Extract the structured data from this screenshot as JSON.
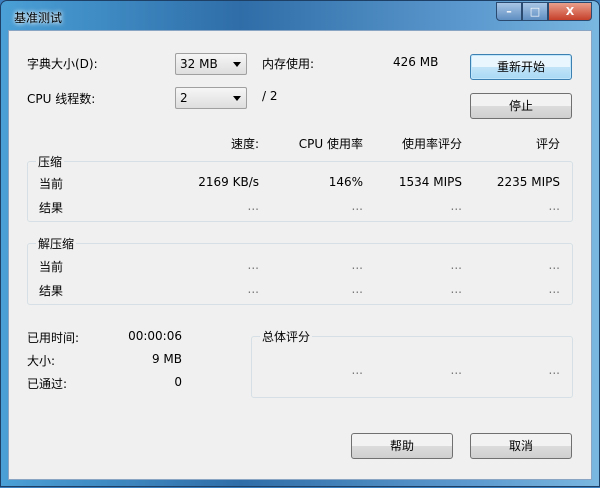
{
  "window": {
    "title": "基准测试",
    "minimize": "–",
    "maximize": "□",
    "close": "X"
  },
  "settings": {
    "dict_label": "字典大小(D):",
    "dict_value": "32 MB",
    "mem_label": "内存使用:",
    "mem_value": "426 MB",
    "threads_label": "CPU 线程数:",
    "threads_value": "2",
    "threads_total": "/ 2"
  },
  "buttons": {
    "restart": "重新开始",
    "stop": "停止",
    "help": "帮助",
    "cancel": "取消"
  },
  "columns": [
    "速度:",
    "CPU 使用率",
    "使用率评分",
    "评分"
  ],
  "compress": {
    "title": "压缩",
    "rows": [
      {
        "label": "当前",
        "values": [
          "2169 KB/s",
          "146%",
          "1534 MIPS",
          "2235 MIPS"
        ]
      },
      {
        "label": "结果",
        "values": [
          "...",
          "...",
          "...",
          "..."
        ]
      }
    ]
  },
  "decompress": {
    "title": "解压缩",
    "rows": [
      {
        "label": "当前",
        "values": [
          "...",
          "...",
          "...",
          "..."
        ]
      },
      {
        "label": "结果",
        "values": [
          "...",
          "...",
          "...",
          "..."
        ]
      }
    ]
  },
  "stats": {
    "elapsed_label": "已用时间:",
    "elapsed": "00:00:06",
    "size_label": "大小:",
    "size": "9 MB",
    "passed_label": "已通过:",
    "passed": "0"
  },
  "overall": {
    "title": "总体评分",
    "values": [
      "...",
      "...",
      "..."
    ]
  }
}
